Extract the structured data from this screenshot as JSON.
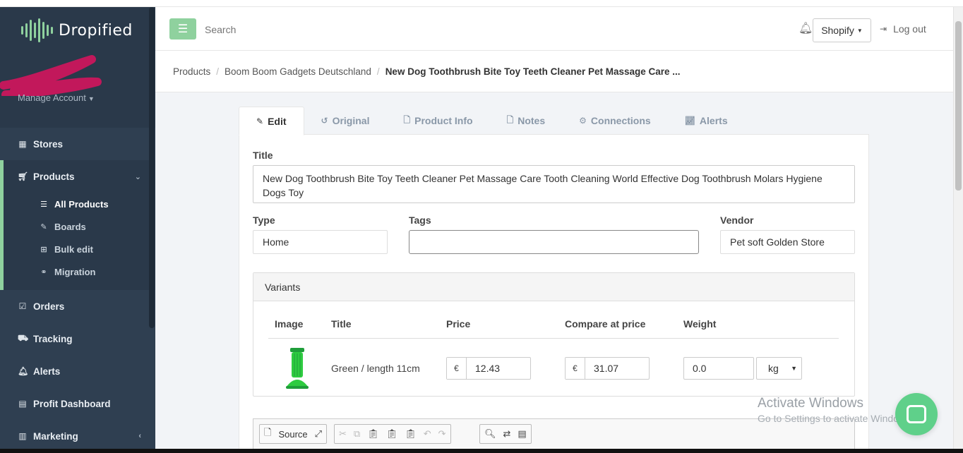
{
  "brand": {
    "name": "Dropified"
  },
  "sidebar": {
    "manage_account": "Manage Account",
    "items": [
      {
        "label": "Stores",
        "icon": "grid-icon"
      },
      {
        "label": "Products",
        "icon": "cart-icon"
      },
      {
        "label": "Orders",
        "icon": "calendar-check-icon"
      },
      {
        "label": "Tracking",
        "icon": "truck-icon"
      },
      {
        "label": "Alerts",
        "icon": "bell-icon"
      },
      {
        "label": "Profit Dashboard",
        "icon": "calculator-icon"
      },
      {
        "label": "Marketing",
        "icon": "bar-chart-icon"
      }
    ],
    "products_sub": [
      {
        "label": "All Products",
        "icon": "list-icon"
      },
      {
        "label": "Boards",
        "icon": "edit-icon"
      },
      {
        "label": "Bulk edit",
        "icon": "table-icon"
      },
      {
        "label": "Migration",
        "icon": "link-icon"
      }
    ]
  },
  "header": {
    "search_placeholder": "Search",
    "store_selector": "Shopify",
    "logout": "Log out"
  },
  "breadcrumb": {
    "items": [
      "Products",
      "Boom Boom Gadgets Deutschland"
    ],
    "current": "New Dog Toothbrush Bite Toy Teeth Cleaner Pet Massage Care ..."
  },
  "tabs": [
    {
      "label": "Edit",
      "icon": "edit-icon",
      "active": true
    },
    {
      "label": "Original",
      "icon": "history-icon"
    },
    {
      "label": "Product Info",
      "icon": "file-icon"
    },
    {
      "label": "Notes",
      "icon": "file-icon"
    },
    {
      "label": "Connections",
      "icon": "cogs-icon"
    },
    {
      "label": "Alerts",
      "icon": "line-chart-icon"
    }
  ],
  "form": {
    "title_label": "Title",
    "title_value": "New Dog Toothbrush Bite Toy Teeth Cleaner Pet Massage Care Tooth Cleaning World Effective Dog Toothbrush Molars Hygiene Dogs Toy",
    "type_label": "Type",
    "type_value": "Home",
    "tags_label": "Tags",
    "tags_value": "",
    "vendor_label": "Vendor",
    "vendor_value": "Pet soft Golden Store"
  },
  "variants": {
    "heading": "Variants",
    "columns": [
      "Image",
      "Title",
      "Price",
      "Compare at price",
      "Weight"
    ],
    "rows": [
      {
        "title": "Green / length 11cm",
        "currency": "€",
        "price": "12.43",
        "compare_price": "31.07",
        "weight": "0.0",
        "weight_unit": "kg"
      }
    ]
  },
  "editor": {
    "source_label": "Source"
  },
  "watermark": {
    "line1": "Activate Windows",
    "line2": "Go to Settings to activate Windows."
  },
  "colors": {
    "accent": "#8fd19e",
    "sidebar_bg": "#2f3f51",
    "chat_bubble": "#5fd08a"
  }
}
